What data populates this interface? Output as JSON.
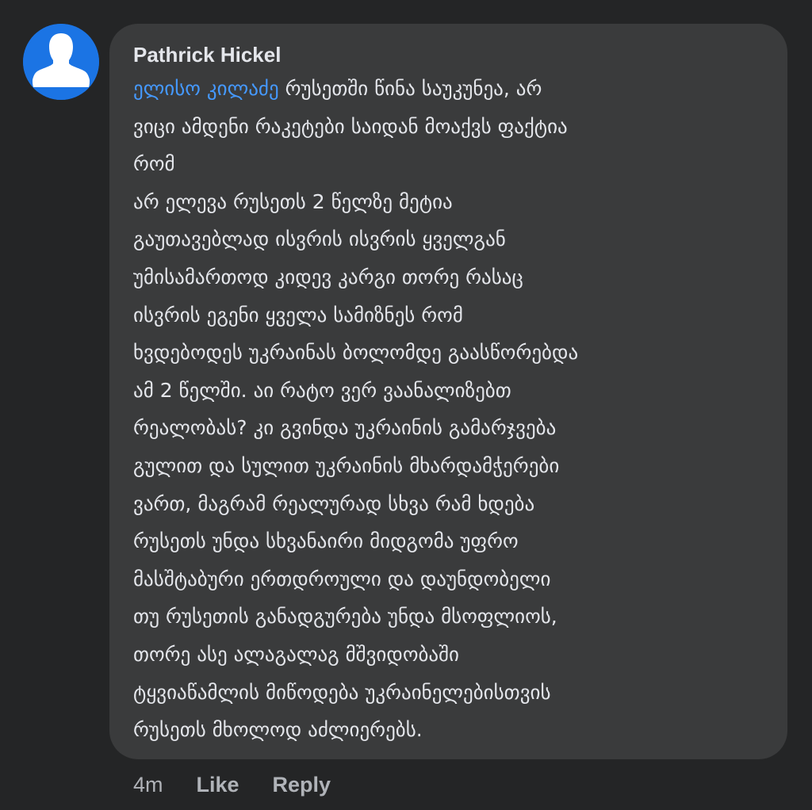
{
  "comment": {
    "author": "Pathrick Hickel",
    "mention": "ელისო კილაძე",
    "first_line_rest": " რუსეთში წინა საუკუნეა, არ",
    "lines": [
      "ვიცი ამდენი რაკეტები საიდან მოაქვს ფაქტია",
      "რომ",
      "არ ელევა რუსეთს 2 წელზე მეტია",
      "გაუთავებლად ისვრის ისვრის ყველგან",
      "უმისამართოდ კიდევ კარგი თორე რასაც",
      "ისვრის ეგენი ყველა სამიზნეს რომ",
      "ხვდებოდეს უკრაინას ბოლომდე გაასწორებდა",
      "ამ 2 წელში. აი რატო ვერ ვაანალიზებთ",
      "რეალობას? კი გვინდა უკრაინის გამარჯვება",
      "გულით და სულით უკრაინის მხარდამჭერები",
      "ვართ, მაგრამ რეალურად სხვა რამ ხდება",
      "რუსეთს უნდა სხვანაირი მიდგომა უფრო",
      "მასშტაბური ერთდროული და დაუნდობელი",
      "თუ რუსეთის განადგურება უნდა მსოფლიოს,",
      "თორე ასე ალაგალაგ მშვიდობაში",
      "ტყვიაწამლის მიწოდება უკრაინელებისთვის",
      "რუსეთს მხოლოდ აძლიერებს."
    ]
  },
  "footer": {
    "time": "4m",
    "like_label": "Like",
    "reply_label": "Reply"
  },
  "colors": {
    "background": "#242526",
    "bubble": "#3a3b3c",
    "text": "#e4e6eb",
    "mention": "#4599ff",
    "secondary": "#b0b3b8",
    "avatar": "#1b74e4"
  },
  "icons": {
    "avatar": "default-profile-silhouette-icon"
  }
}
